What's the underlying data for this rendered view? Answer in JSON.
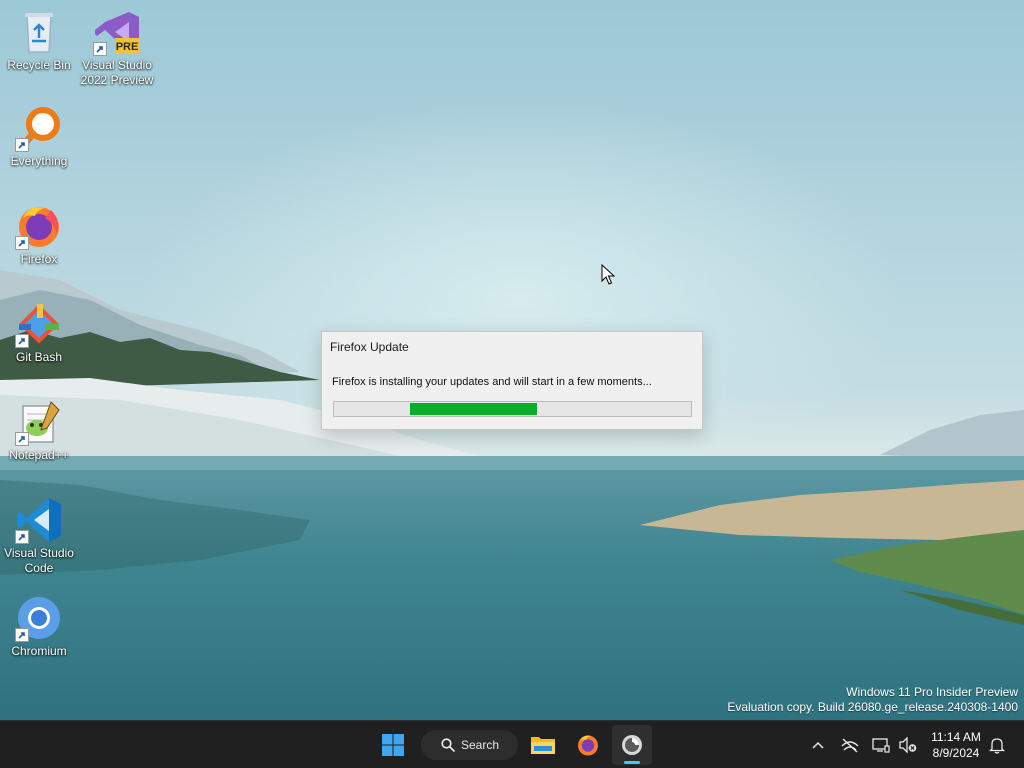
{
  "desktop_icons": [
    {
      "label": "Recycle Bin",
      "icon": "recycle-bin-icon"
    },
    {
      "label": "Visual Studio\n2022 Preview",
      "icon": "visual-studio-icon",
      "badge": "PRE"
    },
    {
      "label": "Everything",
      "icon": "everything-search-icon"
    },
    {
      "label": "Firefox",
      "icon": "firefox-icon"
    },
    {
      "label": "Git Bash",
      "icon": "git-bash-icon"
    },
    {
      "label": "Notepad++",
      "icon": "notepad-plus-plus-icon"
    },
    {
      "label": "Visual Studio\nCode",
      "icon": "vscode-icon"
    },
    {
      "label": "Chromium",
      "icon": "chromium-icon"
    }
  ],
  "dialog": {
    "title": "Firefox Update",
    "message": "Firefox is installing your updates and will start in a few moments...",
    "progress_color": "#06b025"
  },
  "watermark": {
    "line1": "Windows 11 Pro Insider Preview",
    "line2": "Evaluation copy. Build 26080.ge_release.240308-1400"
  },
  "taskbar": {
    "search_label": "Search",
    "pinned": [
      "start-icon",
      "search-icon",
      "file-explorer-icon",
      "firefox-icon",
      "firefox-updater-icon"
    ],
    "tray": [
      "chevron-up-icon",
      "network-icon",
      "display-icon",
      "volume-muted-icon",
      "notification-bell-icon"
    ],
    "clock": {
      "time": "11:14 AM",
      "date": "8/9/2024"
    },
    "accent": "#4cc2ff"
  }
}
